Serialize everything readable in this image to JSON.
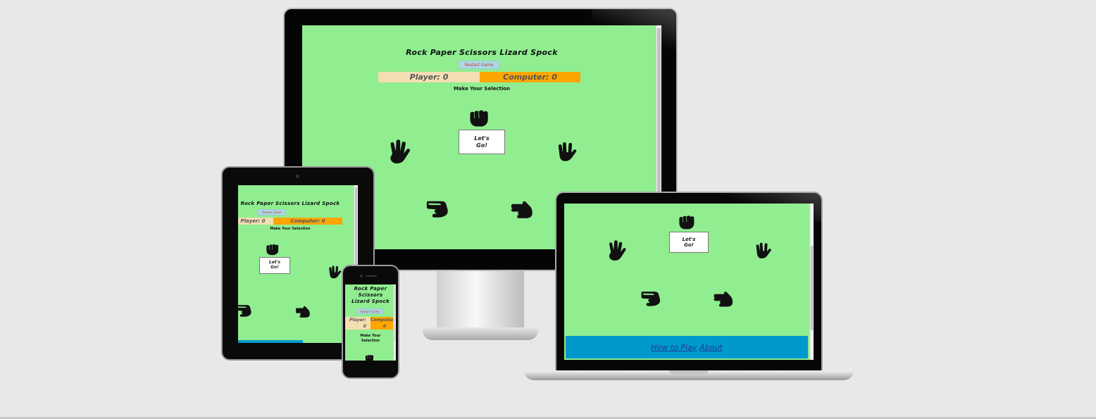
{
  "app": {
    "title": "Rock Paper Scissors Lizard Spock",
    "restart_label": "Restart Game",
    "player_score": "Player: 0",
    "computer_score": "Computer: 0",
    "player_label": "Player:",
    "computer_label": "Computer:",
    "player_value": "0",
    "computer_value": "0",
    "prompt": "Make Your Selection",
    "go_label": "Let's Go!",
    "nav_links": [
      "How to Play",
      "About"
    ]
  },
  "colors": {
    "page_bg": "#90ee90",
    "restart_bg": "#add8e6",
    "player_bg": "#f5deb3",
    "computer_bg": "#ffa500",
    "nav_bg": "#0099cc"
  },
  "icons": [
    "rock-icon",
    "paper-icon",
    "scissors-icon",
    "lizard-icon",
    "spock-icon"
  ]
}
